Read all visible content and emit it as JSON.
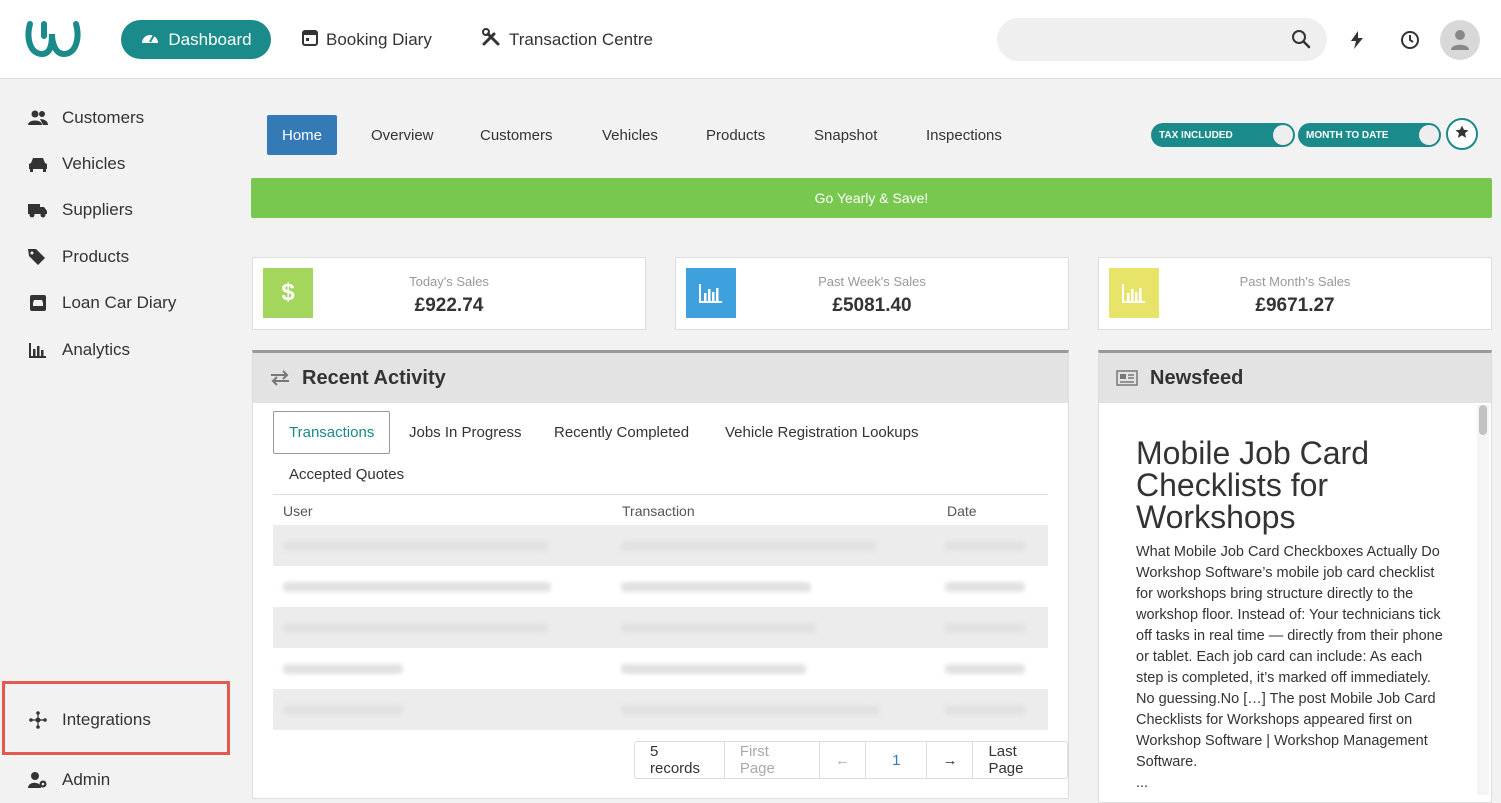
{
  "topnav": {
    "dashboard": "Dashboard",
    "booking_diary": "Booking Diary",
    "transaction_centre": "Transaction Centre",
    "search_placeholder": ""
  },
  "sidebar": {
    "items": [
      {
        "label": "Customers",
        "icon": "users-icon"
      },
      {
        "label": "Vehicles",
        "icon": "car-icon"
      },
      {
        "label": "Suppliers",
        "icon": "truck-icon"
      },
      {
        "label": "Products",
        "icon": "tags-icon"
      },
      {
        "label": "Loan Car Diary",
        "icon": "loan-car-icon"
      },
      {
        "label": "Analytics",
        "icon": "bar-chart-icon"
      },
      {
        "label": "Integrations",
        "icon": "integrations-icon"
      },
      {
        "label": "Admin",
        "icon": "user-gear-icon"
      }
    ]
  },
  "tabs": [
    "Home",
    "Overview",
    "Customers",
    "Vehicles",
    "Products",
    "Snapshot",
    "Inspections"
  ],
  "toggles": {
    "tax": "TAX INCLUDED",
    "period": "MONTH TO DATE"
  },
  "promo": "Go Yearly & Save!",
  "stats": [
    {
      "title": "Today's Sales",
      "value": "£922.74",
      "color": "#a4d65e"
    },
    {
      "title": "Past Week's Sales",
      "value": "£5081.40",
      "color": "#3ea0dc"
    },
    {
      "title": "Past Month's Sales",
      "value": "£9671.27",
      "color": "#e8e46a"
    }
  ],
  "recent_activity": {
    "title": "Recent Activity",
    "tabs": [
      "Transactions",
      "Jobs In Progress",
      "Recently Completed",
      "Vehicle Registration Lookups",
      "Accepted Quotes"
    ],
    "columns": [
      "User",
      "Transaction",
      "Date"
    ],
    "pager": {
      "records": "5 records",
      "first": "First Page",
      "prev": "←",
      "page": "1",
      "next": "→",
      "last": "Last Page"
    }
  },
  "newsfeed": {
    "title": "Newsfeed",
    "article_title": "Mobile Job Card Checklists for Workshops",
    "article_body": "What Mobile Job Card Checkboxes Actually Do Workshop Software’s mobile job card checklist for workshops bring structure directly to the workshop floor. Instead of: Your technicians tick off tasks in real time — directly from their phone or tablet. Each job card can include: As each step is completed, it’s marked off immediately. No guessing.No […] The post Mobile Job Card Checklists for Workshops appeared first on Workshop Software | Workshop Management Software.",
    "ellipsis": "..."
  },
  "colors": {
    "brand": "#1a8a8a",
    "promo": "#78c850",
    "tab_active": "#337ab7"
  }
}
